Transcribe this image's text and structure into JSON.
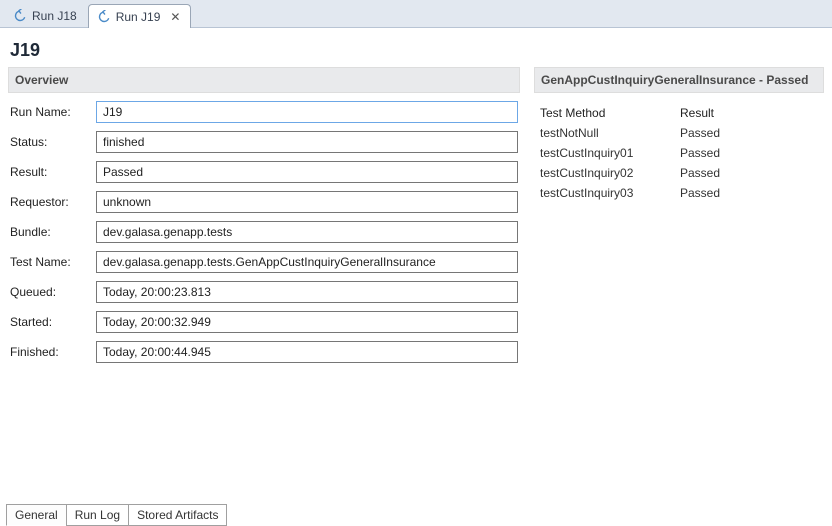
{
  "top_tabs": {
    "items": [
      {
        "label": "Run J18",
        "active": false
      },
      {
        "label": "Run J19",
        "active": true
      }
    ]
  },
  "heading": "J19",
  "overview": {
    "title": "Overview",
    "fields": {
      "run_name": {
        "label": "Run Name:",
        "value": "J19"
      },
      "status": {
        "label": "Status:",
        "value": "finished"
      },
      "result": {
        "label": "Result:",
        "value": "Passed"
      },
      "requestor": {
        "label": "Requestor:",
        "value": "unknown"
      },
      "bundle": {
        "label": "Bundle:",
        "value": "dev.galasa.genapp.tests"
      },
      "test_name": {
        "label": "Test Name:",
        "value": "dev.galasa.genapp.tests.GenAppCustInquiryGeneralInsurance"
      },
      "queued": {
        "label": "Queued:",
        "value": "Today, 20:00:23.813"
      },
      "started": {
        "label": "Started:",
        "value": "Today, 20:00:32.949"
      },
      "finished": {
        "label": "Finished:",
        "value": "Today, 20:00:44.945"
      }
    }
  },
  "tests": {
    "title": "GenAppCustInquiryGeneralInsurance - Passed",
    "header_method": "Test Method",
    "header_result": "Result",
    "rows": [
      {
        "method": "testNotNull",
        "result": "Passed"
      },
      {
        "method": "testCustInquiry01",
        "result": "Passed"
      },
      {
        "method": "testCustInquiry02",
        "result": "Passed"
      },
      {
        "method": "testCustInquiry03",
        "result": "Passed"
      }
    ]
  },
  "bottom_tabs": {
    "items": [
      {
        "label": "General"
      },
      {
        "label": "Run Log"
      },
      {
        "label": "Stored Artifacts"
      }
    ]
  }
}
